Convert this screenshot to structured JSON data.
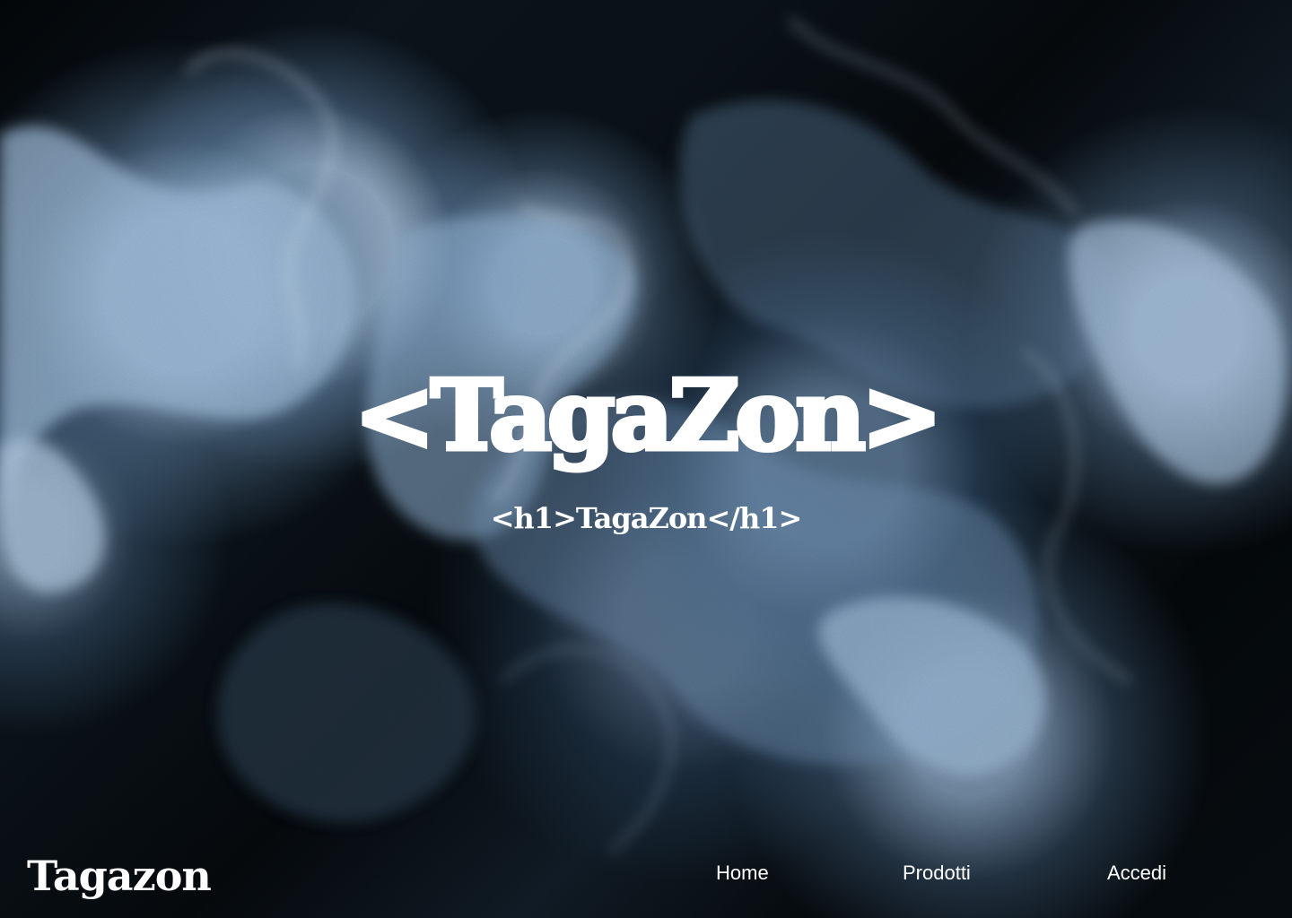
{
  "hero": {
    "logo_text": "<TagaZon>",
    "subtitle": "<h1>TagaZon</h1>"
  },
  "navbar": {
    "brand": "Tagazon",
    "links": {
      "home": "Home",
      "products": "Prodotti",
      "login": "Accedi"
    }
  },
  "colors": {
    "background_dark": "#05080b",
    "marble_light": "#b4cde6",
    "text": "#ffffff"
  }
}
